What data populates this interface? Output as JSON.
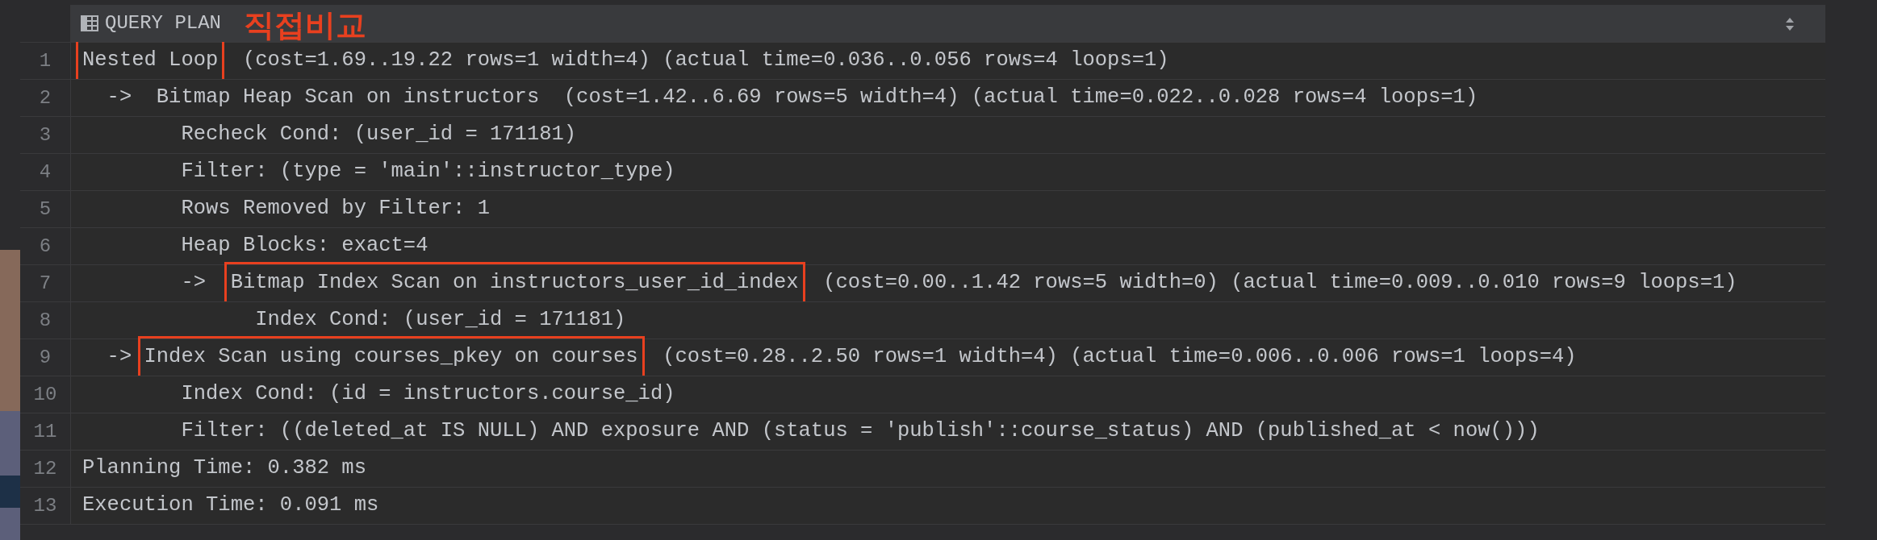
{
  "annotation": {
    "text": "직접비교"
  },
  "header": {
    "title": "QUERY PLAN"
  },
  "rows": [
    {
      "number": "1",
      "segments": [
        {
          "text": "Nested Loop",
          "boxed": true
        },
        {
          "text": "  (cost=1.69..19.22 rows=1 width=4) (actual time=0.036..0.056 rows=4 loops=1)",
          "boxed": false
        }
      ]
    },
    {
      "number": "2",
      "segments": [
        {
          "text": "  ->  Bitmap Heap Scan on instructors  (cost=1.42..6.69 rows=5 width=4) (actual time=0.022..0.028 rows=4 loops=1)",
          "boxed": false
        }
      ]
    },
    {
      "number": "3",
      "segments": [
        {
          "text": "        Recheck Cond: (user_id = 171181)",
          "boxed": false
        }
      ]
    },
    {
      "number": "4",
      "segments": [
        {
          "text": "        Filter: (type = 'main'::instructor_type)",
          "boxed": false
        }
      ]
    },
    {
      "number": "5",
      "segments": [
        {
          "text": "        Rows Removed by Filter: 1",
          "boxed": false
        }
      ]
    },
    {
      "number": "6",
      "segments": [
        {
          "text": "        Heap Blocks: exact=4",
          "boxed": false
        }
      ]
    },
    {
      "number": "7",
      "segments": [
        {
          "text": "        ->  ",
          "boxed": false
        },
        {
          "text": "Bitmap Index Scan on instructors_user_id_index",
          "boxed": true
        },
        {
          "text": "  (cost=0.00..1.42 rows=5 width=0) (actual time=0.009..0.010 rows=9 loops=1)",
          "boxed": false
        }
      ]
    },
    {
      "number": "8",
      "segments": [
        {
          "text": "              Index Cond: (user_id = 171181)",
          "boxed": false
        }
      ]
    },
    {
      "number": "9",
      "segments": [
        {
          "text": "  -> ",
          "boxed": false
        },
        {
          "text": "Index Scan using courses_pkey on courses",
          "boxed": true
        },
        {
          "text": "  (cost=0.28..2.50 rows=1 width=4) (actual time=0.006..0.006 rows=1 loops=4)",
          "boxed": false
        }
      ]
    },
    {
      "number": "10",
      "segments": [
        {
          "text": "        Index Cond: (id = instructors.course_id)",
          "boxed": false
        }
      ]
    },
    {
      "number": "11",
      "segments": [
        {
          "text": "        Filter: ((deleted_at IS NULL) AND exposure AND (status = 'publish'::course_status) AND (published_at < now()))",
          "boxed": false
        }
      ]
    },
    {
      "number": "12",
      "segments": [
        {
          "text": "Planning Time: 0.382 ms",
          "boxed": false
        }
      ]
    },
    {
      "number": "13",
      "segments": [
        {
          "text": "Execution Time: 0.091 ms",
          "boxed": false
        }
      ]
    }
  ]
}
